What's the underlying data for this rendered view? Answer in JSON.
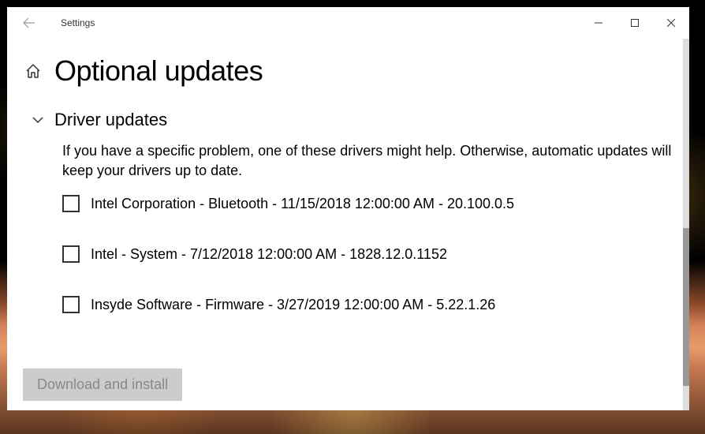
{
  "titlebar": {
    "title": "Settings"
  },
  "page": {
    "title": "Optional updates"
  },
  "section": {
    "title": "Driver updates",
    "description": "If you have a specific problem, one of these drivers might help. Otherwise, automatic updates will keep your drivers up to date.",
    "updates": [
      {
        "label": "Intel Corporation - Bluetooth - 11/15/2018 12:00:00 AM - 20.100.0.5"
      },
      {
        "label": "Intel - System - 7/12/2018 12:00:00 AM - 1828.12.0.1152"
      },
      {
        "label": "Insyde Software - Firmware - 3/27/2019 12:00:00 AM - 5.22.1.26"
      }
    ]
  },
  "actions": {
    "download": "Download and install"
  }
}
